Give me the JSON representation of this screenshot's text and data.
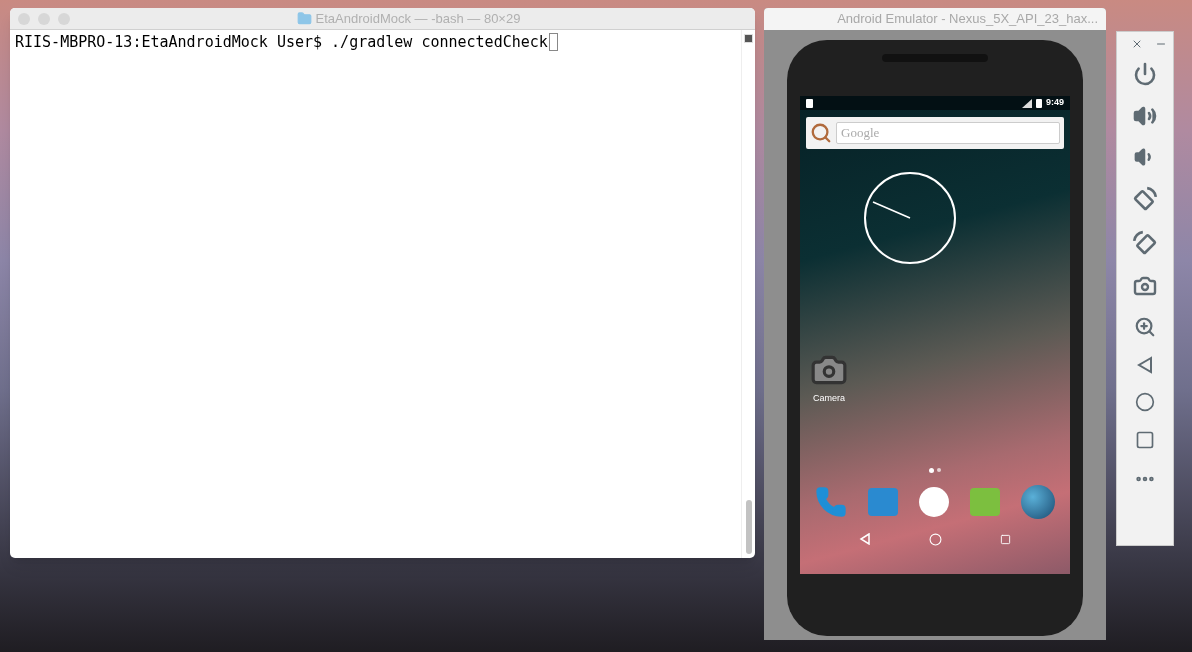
{
  "terminal": {
    "title": "EtaAndroidMock — -bash — 80×29",
    "lines": [
      "RIIS-MBPRO-13:EtaAndroidMock User$ ./gradlew connectedCheck"
    ]
  },
  "emulator": {
    "title": "Android Emulator - Nexus_5X_API_23_hax...",
    "status_time": "9:49",
    "search": {
      "placeholder": "Google"
    },
    "apps": [
      "Camera"
    ]
  }
}
